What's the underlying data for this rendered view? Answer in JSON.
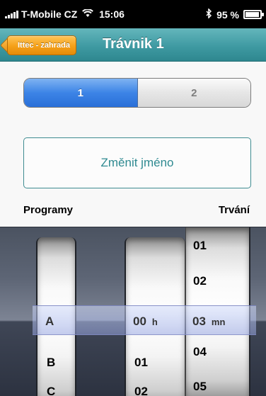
{
  "status": {
    "carrier": "T-Mobile CZ",
    "time": "15:06",
    "battery": "95 %",
    "battery_level": 0.95
  },
  "nav": {
    "back_label": "Ittec - zahrada",
    "title": "Trávnik 1"
  },
  "segments": [
    "1",
    "2"
  ],
  "selected_segment": 0,
  "rename_label": "Změnit jméno",
  "labels": {
    "programs": "Programy",
    "duration": "Trvání"
  },
  "picker": {
    "programs": [
      "A",
      "B",
      "C"
    ],
    "selected_program": "A",
    "hours": [
      "00",
      "01",
      "02"
    ],
    "selected_hour": "00",
    "hour_unit": "h",
    "minutes": [
      "01",
      "02",
      "03",
      "04",
      "05"
    ],
    "selected_minute": "03",
    "minute_unit": "mn"
  }
}
